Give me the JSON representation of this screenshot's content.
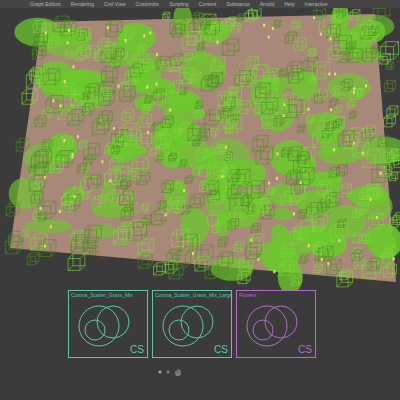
{
  "menu": {
    "items": [
      "Graph Editors",
      "Rendering",
      "Civil View",
      "Customize",
      "Scripting",
      "Content",
      "Substance",
      "Arnold",
      "Help",
      "Interactive"
    ]
  },
  "helpers": [
    {
      "label": "Corona_Scatter_Grass_Mix",
      "badge": "CS",
      "color": "#5cc8a8"
    },
    {
      "label": "Corona_Scatter_Grass_Mix_Large",
      "badge": "CS",
      "color": "#5cc8a8"
    },
    {
      "label": "Flowers",
      "badge": "CS",
      "color": "#b46ccc"
    }
  ]
}
